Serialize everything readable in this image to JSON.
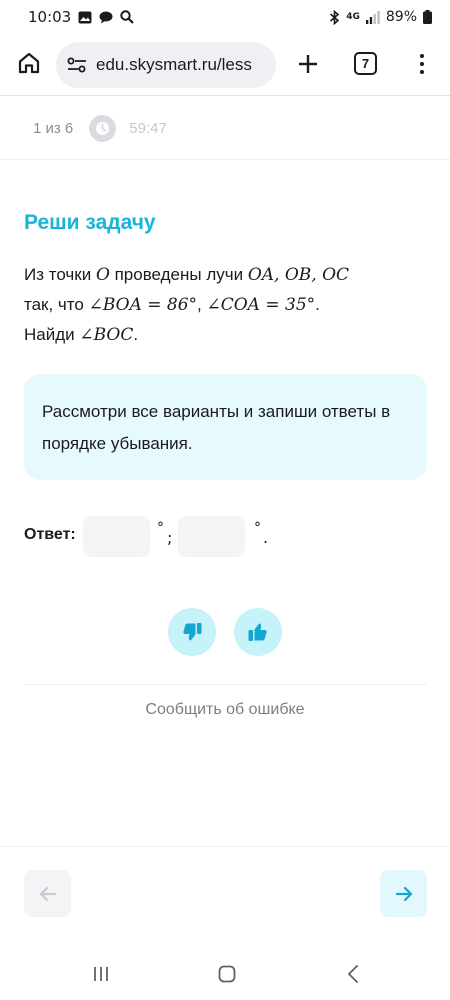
{
  "status_bar": {
    "time": "10:03",
    "network": "4G",
    "battery": "89%"
  },
  "browser": {
    "url": "edu.skysmart.ru/less",
    "tab_count": "7"
  },
  "progress": {
    "counter": "1 из 6",
    "timer": "59:47"
  },
  "task": {
    "title": "Реши задачу",
    "line1_prefix": "Из точки ",
    "point": "O",
    "line1_mid": " проведены лучи ",
    "rays": "OA, OB, OC",
    "line2_prefix": "так, что ",
    "angle1": "∠BOA = 86°",
    "comma": ", ",
    "angle2": "∠COA = 35°",
    "dot": ".",
    "line3_prefix": "Найди ",
    "angle3": "∠BOC",
    "line3_suffix": "."
  },
  "hint": {
    "text": "Рассмотри все варианты и запиши ответы в порядке убывания."
  },
  "answer": {
    "label": "Ответ:",
    "input1_value": "",
    "input2_value": "",
    "degree": "°",
    "separator": ";",
    "end": "."
  },
  "feedback": {
    "dislike_icon": "thumbs-down-icon",
    "like_icon": "thumbs-up-icon"
  },
  "report": {
    "label": "Сообщить об ошибке"
  },
  "colors": {
    "accent": "#19b4d9",
    "hint_bg": "#e6fafd",
    "rate_bg": "#c6f2f9",
    "arrow_next": "#14a8cf"
  }
}
